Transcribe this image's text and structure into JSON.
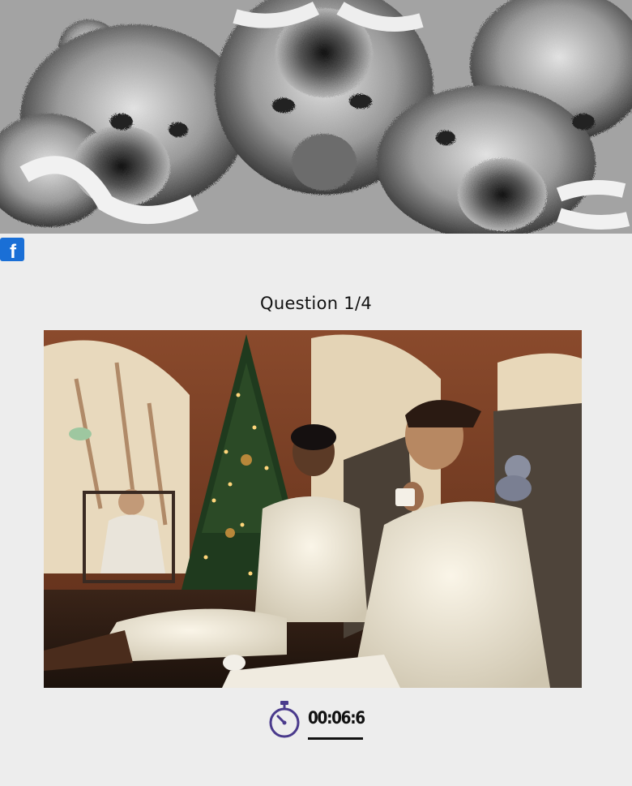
{
  "banner": {
    "description_icon": "teddy-bears-banner",
    "bg_color": "#a3a3a3"
  },
  "social": {
    "facebook_glyph": "f",
    "icon": "facebook-icon",
    "color": "#1a6fd6"
  },
  "quiz": {
    "question_label": "Question 1/4"
  },
  "photo": {
    "icon": "spa-christmas-photo"
  },
  "timer": {
    "icon": "stopwatch-icon",
    "value": "00:06:6",
    "color": "#4a3a8c"
  }
}
